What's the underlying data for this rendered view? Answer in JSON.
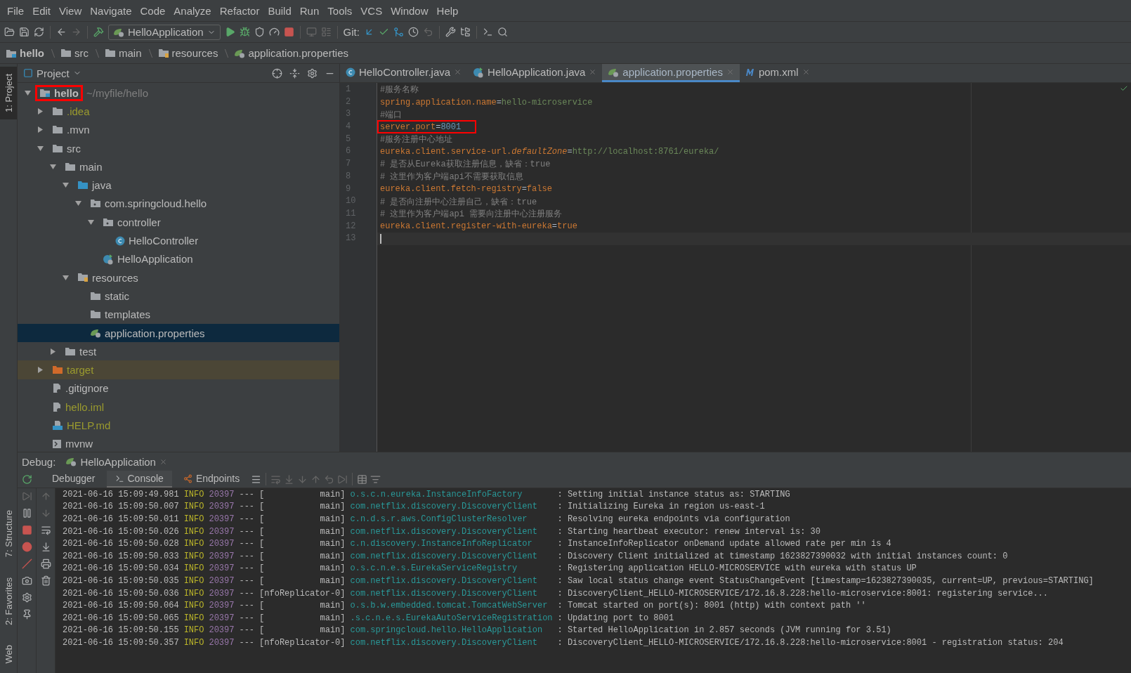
{
  "menu": [
    "File",
    "Edit",
    "View",
    "Navigate",
    "Code",
    "Analyze",
    "Refactor",
    "Build",
    "Run",
    "Tools",
    "VCS",
    "Window",
    "Help"
  ],
  "toolbar": {
    "run_config": "HelloApplication",
    "git_label": "Git:"
  },
  "breadcrumbs": [
    {
      "label": "hello",
      "kind": "module"
    },
    {
      "label": "src",
      "kind": "folder"
    },
    {
      "label": "main",
      "kind": "folder"
    },
    {
      "label": "resources",
      "kind": "resources"
    },
    {
      "label": "application.properties",
      "kind": "properties"
    }
  ],
  "side_tools": {
    "top": [
      {
        "label": "1: Project",
        "selected": true
      }
    ],
    "bottom": [
      {
        "label": "7: Structure",
        "selected": false
      },
      {
        "label": "2: Favorites",
        "selected": false
      },
      {
        "label": "Web",
        "selected": false
      }
    ]
  },
  "project": {
    "title": "Project",
    "tree": [
      {
        "label": "hello",
        "path": "~/myfile/hello",
        "kind": "module",
        "expanded": true,
        "selected": false,
        "ignored": false,
        "annotated": true,
        "children": [
          {
            "label": ".idea",
            "kind": "folder",
            "expanded": false,
            "selected": false,
            "ignored": true,
            "annotated": false
          },
          {
            "label": ".mvn",
            "kind": "folder",
            "expanded": false,
            "selected": false,
            "ignored": false,
            "annotated": false
          },
          {
            "label": "src",
            "kind": "folder",
            "expanded": true,
            "selected": false,
            "ignored": false,
            "annotated": false,
            "children": [
              {
                "label": "main",
                "kind": "folder",
                "expanded": true,
                "selected": false,
                "ignored": false,
                "annotated": false,
                "children": [
                  {
                    "label": "java",
                    "kind": "source-folder",
                    "expanded": true,
                    "selected": false,
                    "ignored": false,
                    "annotated": false,
                    "children": [
                      {
                        "label": "com.springcloud.hello",
                        "kind": "package",
                        "expanded": true,
                        "selected": false,
                        "ignored": false,
                        "annotated": false,
                        "children": [
                          {
                            "label": "controller",
                            "kind": "package",
                            "expanded": true,
                            "selected": false,
                            "ignored": false,
                            "annotated": false,
                            "children": [
                              {
                                "label": "HelloController",
                                "kind": "class",
                                "selected": false,
                                "ignored": false,
                                "annotated": false
                              }
                            ]
                          },
                          {
                            "label": "HelloApplication",
                            "kind": "spring-boot",
                            "selected": false,
                            "ignored": false,
                            "annotated": false
                          }
                        ]
                      }
                    ]
                  },
                  {
                    "label": "resources",
                    "kind": "resources",
                    "expanded": true,
                    "selected": false,
                    "ignored": false,
                    "annotated": false,
                    "children": [
                      {
                        "label": "static",
                        "kind": "folder",
                        "selected": false,
                        "ignored": false,
                        "annotated": false
                      },
                      {
                        "label": "templates",
                        "kind": "folder",
                        "selected": false,
                        "ignored": false,
                        "annotated": false
                      },
                      {
                        "label": "application.properties",
                        "kind": "properties",
                        "selected": true,
                        "ignored": false,
                        "annotated": false
                      }
                    ]
                  }
                ]
              },
              {
                "label": "test",
                "kind": "folder",
                "expanded": false,
                "selected": false,
                "ignored": false,
                "annotated": false
              }
            ]
          },
          {
            "label": "target",
            "kind": "excluded",
            "expanded": false,
            "selected": false,
            "ignored": true,
            "annotated": false
          },
          {
            "label": ".gitignore",
            "kind": "file",
            "selected": false,
            "ignored": false,
            "annotated": false
          },
          {
            "label": "hello.iml",
            "kind": "file",
            "selected": false,
            "ignored": true,
            "annotated": false
          },
          {
            "label": "HELP.md",
            "kind": "markdown",
            "selected": false,
            "ignored": true,
            "annotated": false
          },
          {
            "label": "mvnw",
            "kind": "script",
            "selected": false,
            "ignored": false,
            "annotated": false
          }
        ]
      }
    ]
  },
  "editor": {
    "tabs": [
      {
        "label": "HelloController.java",
        "kind": "class",
        "selected": false
      },
      {
        "label": "HelloApplication.java",
        "kind": "spring-boot",
        "selected": false
      },
      {
        "label": "application.properties",
        "kind": "properties",
        "selected": true
      },
      {
        "label": "pom.xml",
        "kind": "maven",
        "selected": false
      }
    ],
    "lines": [
      {
        "number": "1",
        "current": false,
        "annotated": false,
        "tokens": [
          {
            "kind": "comment",
            "text": "#服务名称"
          }
        ]
      },
      {
        "number": "2",
        "current": false,
        "annotated": false,
        "tokens": [
          {
            "kind": "key",
            "text": "spring.application.name"
          },
          {
            "kind": "op",
            "text": "="
          },
          {
            "kind": "value",
            "text": "hello-microservice"
          }
        ]
      },
      {
        "number": "3",
        "current": false,
        "annotated": false,
        "tokens": [
          {
            "kind": "comment",
            "text": "#端口"
          }
        ]
      },
      {
        "number": "4",
        "current": false,
        "annotated": true,
        "tokens": [
          {
            "kind": "key",
            "text": "server.port"
          },
          {
            "kind": "op",
            "text": "="
          },
          {
            "kind": "number",
            "text": "8001"
          }
        ]
      },
      {
        "number": "5",
        "current": false,
        "annotated": false,
        "tokens": [
          {
            "kind": "comment",
            "text": "#服务注册中心地址"
          }
        ]
      },
      {
        "number": "6",
        "current": false,
        "annotated": false,
        "tokens": [
          {
            "kind": "key",
            "text": "eureka.client.service-url."
          },
          {
            "kind": "italic-key",
            "text": "defaultZone"
          },
          {
            "kind": "op",
            "text": "="
          },
          {
            "kind": "value",
            "text": "http://localhost:8761/eureka/"
          }
        ]
      },
      {
        "number": "7",
        "current": false,
        "annotated": false,
        "tokens": [
          {
            "kind": "comment",
            "text": "# 是否从Eureka获取注册信息，缺省：true"
          }
        ]
      },
      {
        "number": "8",
        "current": false,
        "annotated": false,
        "tokens": [
          {
            "kind": "comment",
            "text": "# 这里作为客户端api不需要获取信息"
          }
        ]
      },
      {
        "number": "9",
        "current": false,
        "annotated": false,
        "tokens": [
          {
            "kind": "key",
            "text": "eureka.client.fetch-registry"
          },
          {
            "kind": "op",
            "text": "="
          },
          {
            "kind": "key",
            "text": "false"
          }
        ]
      },
      {
        "number": "10",
        "current": false,
        "annotated": false,
        "tokens": [
          {
            "kind": "comment",
            "text": "# 是否向注册中心注册自己，缺省：true"
          }
        ]
      },
      {
        "number": "11",
        "current": false,
        "annotated": false,
        "tokens": [
          {
            "kind": "comment",
            "text": "# 这里作为客户端api 需要向注册中心注册服务"
          }
        ]
      },
      {
        "number": "12",
        "current": false,
        "annotated": false,
        "tokens": [
          {
            "kind": "key",
            "text": "eureka.client.register-with-eureka"
          },
          {
            "kind": "op",
            "text": "="
          },
          {
            "kind": "key",
            "text": "true"
          }
        ]
      },
      {
        "number": "13",
        "current": true,
        "annotated": false
      }
    ]
  },
  "debug": {
    "label": "Debug:",
    "session": "HelloApplication",
    "tabs": [
      {
        "label": "Debugger",
        "kind": "plain",
        "selected": false
      },
      {
        "label": "Console",
        "kind": "console",
        "selected": true
      },
      {
        "label": "Endpoints",
        "kind": "endpoints",
        "selected": false
      }
    ],
    "log": [
      {
        "time": "2021-06-16 15:09:49.981",
        "level": "INFO",
        "pid": "20397",
        "sep": "---",
        "thread": "[           main]",
        "logger": "o.s.c.n.eureka.InstanceInfoFactory",
        "message": ": Setting initial instance status as: STARTING"
      },
      {
        "time": "2021-06-16 15:09:50.007",
        "level": "INFO",
        "pid": "20397",
        "sep": "---",
        "thread": "[           main]",
        "logger": "com.netflix.discovery.DiscoveryClient",
        "message": ": Initializing Eureka in region us-east-1"
      },
      {
        "time": "2021-06-16 15:09:50.011",
        "level": "INFO",
        "pid": "20397",
        "sep": "---",
        "thread": "[           main]",
        "logger": "c.n.d.s.r.aws.ConfigClusterResolver",
        "message": ": Resolving eureka endpoints via configuration"
      },
      {
        "time": "2021-06-16 15:09:50.026",
        "level": "INFO",
        "pid": "20397",
        "sep": "---",
        "thread": "[           main]",
        "logger": "com.netflix.discovery.DiscoveryClient",
        "message": ": Starting heartbeat executor: renew interval is: 30"
      },
      {
        "time": "2021-06-16 15:09:50.028",
        "level": "INFO",
        "pid": "20397",
        "sep": "---",
        "thread": "[           main]",
        "logger": "c.n.discovery.InstanceInfoReplicator",
        "message": ": InstanceInfoReplicator onDemand update allowed rate per min is 4"
      },
      {
        "time": "2021-06-16 15:09:50.033",
        "level": "INFO",
        "pid": "20397",
        "sep": "---",
        "thread": "[           main]",
        "logger": "com.netflix.discovery.DiscoveryClient",
        "message": ": Discovery Client initialized at timestamp 1623827390032 with initial instances count: 0"
      },
      {
        "time": "2021-06-16 15:09:50.034",
        "level": "INFO",
        "pid": "20397",
        "sep": "---",
        "thread": "[           main]",
        "logger": "o.s.c.n.e.s.EurekaServiceRegistry",
        "message": ": Registering application HELLO-MICROSERVICE with eureka with status UP"
      },
      {
        "time": "2021-06-16 15:09:50.035",
        "level": "INFO",
        "pid": "20397",
        "sep": "---",
        "thread": "[           main]",
        "logger": "com.netflix.discovery.DiscoveryClient",
        "message": ": Saw local status change event StatusChangeEvent [timestamp=1623827390035, current=UP, previous=STARTING]"
      },
      {
        "time": "2021-06-16 15:09:50.036",
        "level": "INFO",
        "pid": "20397",
        "sep": "---",
        "thread": "[nfoReplicator-0]",
        "logger": "com.netflix.discovery.DiscoveryClient",
        "message": ": DiscoveryClient_HELLO-MICROSERVICE/172.16.8.228:hello-microservice:8001: registering service..."
      },
      {
        "time": "2021-06-16 15:09:50.064",
        "level": "INFO",
        "pid": "20397",
        "sep": "---",
        "thread": "[           main]",
        "logger": "o.s.b.w.embedded.tomcat.TomcatWebServer",
        "message": ": Tomcat started on port(s): 8001 (http) with context path ''"
      },
      {
        "time": "2021-06-16 15:09:50.065",
        "level": "INFO",
        "pid": "20397",
        "sep": "---",
        "thread": "[           main]",
        "logger": ".s.c.n.e.s.EurekaAutoServiceRegistration",
        "message": ": Updating port to 8001"
      },
      {
        "time": "2021-06-16 15:09:50.155",
        "level": "INFO",
        "pid": "20397",
        "sep": "---",
        "thread": "[           main]",
        "logger": "com.springcloud.hello.HelloApplication",
        "message": ": Started HelloApplication in 2.857 seconds (JVM running for 3.51)"
      },
      {
        "time": "2021-06-16 15:09:50.357",
        "level": "INFO",
        "pid": "20397",
        "sep": "---",
        "thread": "[nfoReplicator-0]",
        "logger": "com.netflix.discovery.DiscoveryClient",
        "message": ": DiscoveryClient_HELLO-MICROSERVICE/172.16.8.228:hello-microservice:8001 - registration status: 204"
      }
    ]
  }
}
